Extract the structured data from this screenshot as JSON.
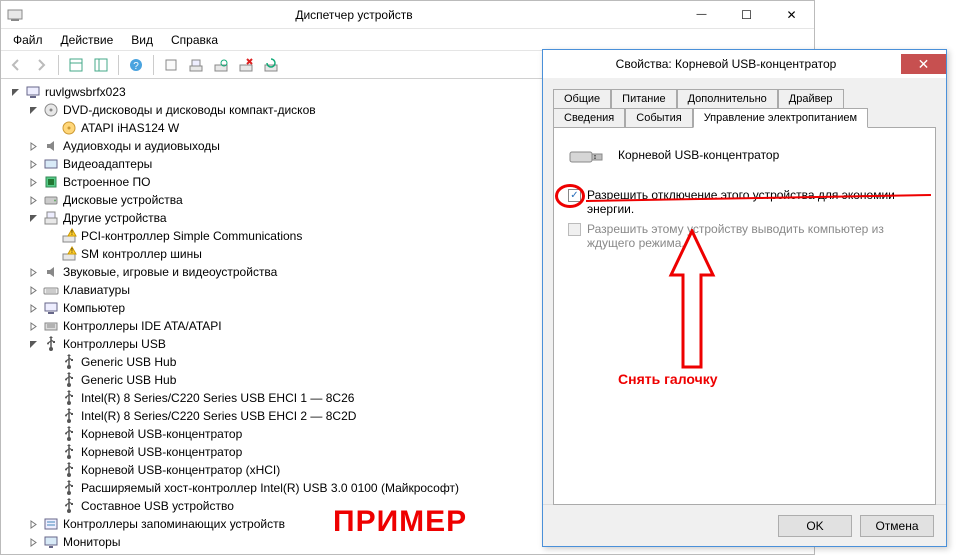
{
  "dm": {
    "title": "Диспетчер устройств",
    "menu": [
      "Файл",
      "Действие",
      "Вид",
      "Справка"
    ],
    "root": "ruvlgwsbrfx023",
    "nodes": [
      {
        "d": 1,
        "exp": "open",
        "icon": "pc",
        "label": "ruvlgwsbrfx023"
      },
      {
        "d": 2,
        "exp": "open",
        "icon": "dvd",
        "label": "DVD-дисководы и дисководы компакт-дисков"
      },
      {
        "d": 3,
        "exp": "",
        "icon": "disc",
        "label": "ATAPI iHAS124   W"
      },
      {
        "d": 2,
        "exp": "closed",
        "icon": "audio",
        "label": "Аудиовходы и аудиовыходы"
      },
      {
        "d": 2,
        "exp": "closed",
        "icon": "video",
        "label": "Видеоадаптеры"
      },
      {
        "d": 2,
        "exp": "closed",
        "icon": "firmware",
        "label": "Встроенное ПО"
      },
      {
        "d": 2,
        "exp": "closed",
        "icon": "hdd",
        "label": "Дисковые устройства"
      },
      {
        "d": 2,
        "exp": "open",
        "icon": "other",
        "label": "Другие устройства"
      },
      {
        "d": 3,
        "exp": "",
        "icon": "warn",
        "label": "PCI-контроллер Simple Communications"
      },
      {
        "d": 3,
        "exp": "",
        "icon": "warn",
        "label": "SM контроллер шины"
      },
      {
        "d": 2,
        "exp": "closed",
        "icon": "audio",
        "label": "Звуковые, игровые и видеоустройства"
      },
      {
        "d": 2,
        "exp": "closed",
        "icon": "keyboard",
        "label": "Клавиатуры"
      },
      {
        "d": 2,
        "exp": "closed",
        "icon": "pc",
        "label": "Компьютер"
      },
      {
        "d": 2,
        "exp": "closed",
        "icon": "ide",
        "label": "Контроллеры IDE ATA/ATAPI"
      },
      {
        "d": 2,
        "exp": "open",
        "icon": "usb",
        "label": "Контроллеры USB"
      },
      {
        "d": 3,
        "exp": "",
        "icon": "usb",
        "label": "Generic USB Hub"
      },
      {
        "d": 3,
        "exp": "",
        "icon": "usb",
        "label": "Generic USB Hub"
      },
      {
        "d": 3,
        "exp": "",
        "icon": "usb",
        "label": "Intel(R) 8 Series/C220 Series USB EHCI 1 — 8C26"
      },
      {
        "d": 3,
        "exp": "",
        "icon": "usb",
        "label": "Intel(R) 8 Series/C220 Series USB EHCI 2 — 8C2D"
      },
      {
        "d": 3,
        "exp": "",
        "icon": "usb",
        "label": "Корневой USB-концентратор"
      },
      {
        "d": 3,
        "exp": "",
        "icon": "usb",
        "label": "Корневой USB-концентратор"
      },
      {
        "d": 3,
        "exp": "",
        "icon": "usb",
        "label": "Корневой USB-концентратор (xHCI)"
      },
      {
        "d": 3,
        "exp": "",
        "icon": "usb",
        "label": "Расширяемый хост-контроллер Intel(R) USB 3.0 0100 (Майкрософт)"
      },
      {
        "d": 3,
        "exp": "",
        "icon": "usb",
        "label": "Составное USB устройство"
      },
      {
        "d": 2,
        "exp": "closed",
        "icon": "storage",
        "label": "Контроллеры запоминающих устройств"
      },
      {
        "d": 2,
        "exp": "closed",
        "icon": "monitor",
        "label": "Мониторы"
      }
    ]
  },
  "props": {
    "title": "Свойства: Корневой USB-концентратор",
    "tabs_row1": [
      "Общие",
      "Питание",
      "Дополнительно",
      "Драйвер"
    ],
    "tabs_row2": [
      "Сведения",
      "События",
      "Управление электропитанием"
    ],
    "active_tab": "Управление электропитанием",
    "device_name": "Корневой USB-концентратор",
    "chk1": "Разрешить отключение этого устройства для экономии энергии.",
    "chk2": "Разрешить этому устройству выводить компьютер из ждущего режима.",
    "ok": "OK",
    "cancel": "Отмена"
  },
  "annotations": {
    "hint": "Снять галочку",
    "example": "ПРИМЕР"
  }
}
